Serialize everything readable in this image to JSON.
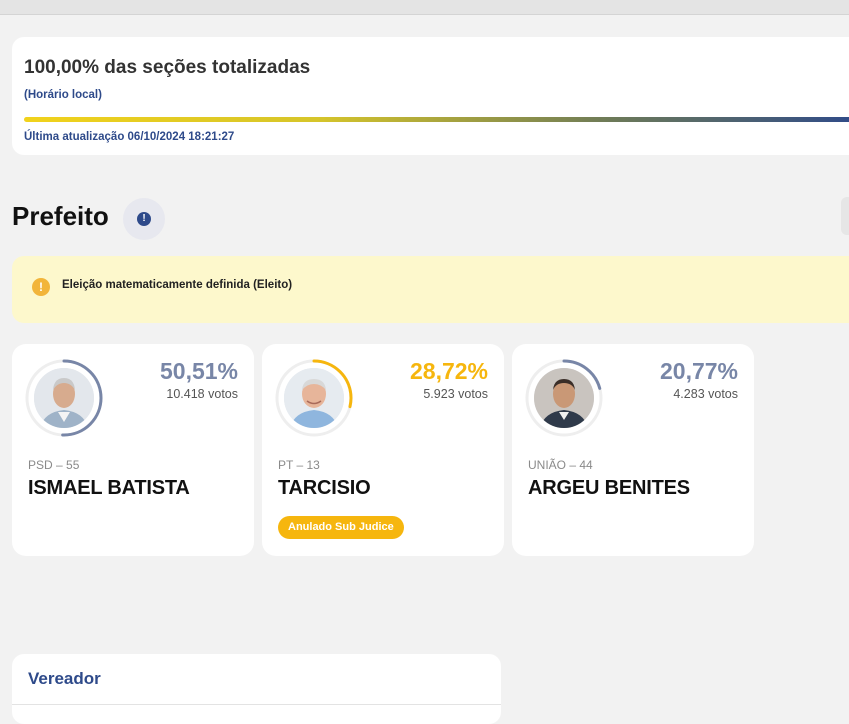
{
  "status": {
    "title": "100,00% das seções totalizadas",
    "local_time_label": "(Horário local)",
    "progress_percent": 100,
    "last_update": "Última atualização 06/10/2024 18:21:27"
  },
  "section": {
    "title": "Prefeito",
    "info_glyph": "!"
  },
  "alert": {
    "icon": "!",
    "text": "Eleição matematicamente definida (Eleito)"
  },
  "candidates": [
    {
      "percent_text": "50,51%",
      "percent": 50.51,
      "votes": "10.418 votos",
      "party": "PSD – 55",
      "name": "ISMAEL BATISTA",
      "badge": "",
      "color": "#7886a7"
    },
    {
      "percent_text": "28,72%",
      "percent": 28.72,
      "votes": "5.923 votos",
      "party": "PT – 13",
      "name": "TARCISIO",
      "badge": "Anulado Sub Judice",
      "color": "#f6b60e"
    },
    {
      "percent_text": "20,77%",
      "percent": 20.77,
      "votes": "4.283 votos",
      "party": "UNIÃO – 44",
      "name": "ARGEU BENITES",
      "badge": "",
      "color": "#7886a7"
    }
  ],
  "vereador": {
    "title": "Vereador"
  }
}
